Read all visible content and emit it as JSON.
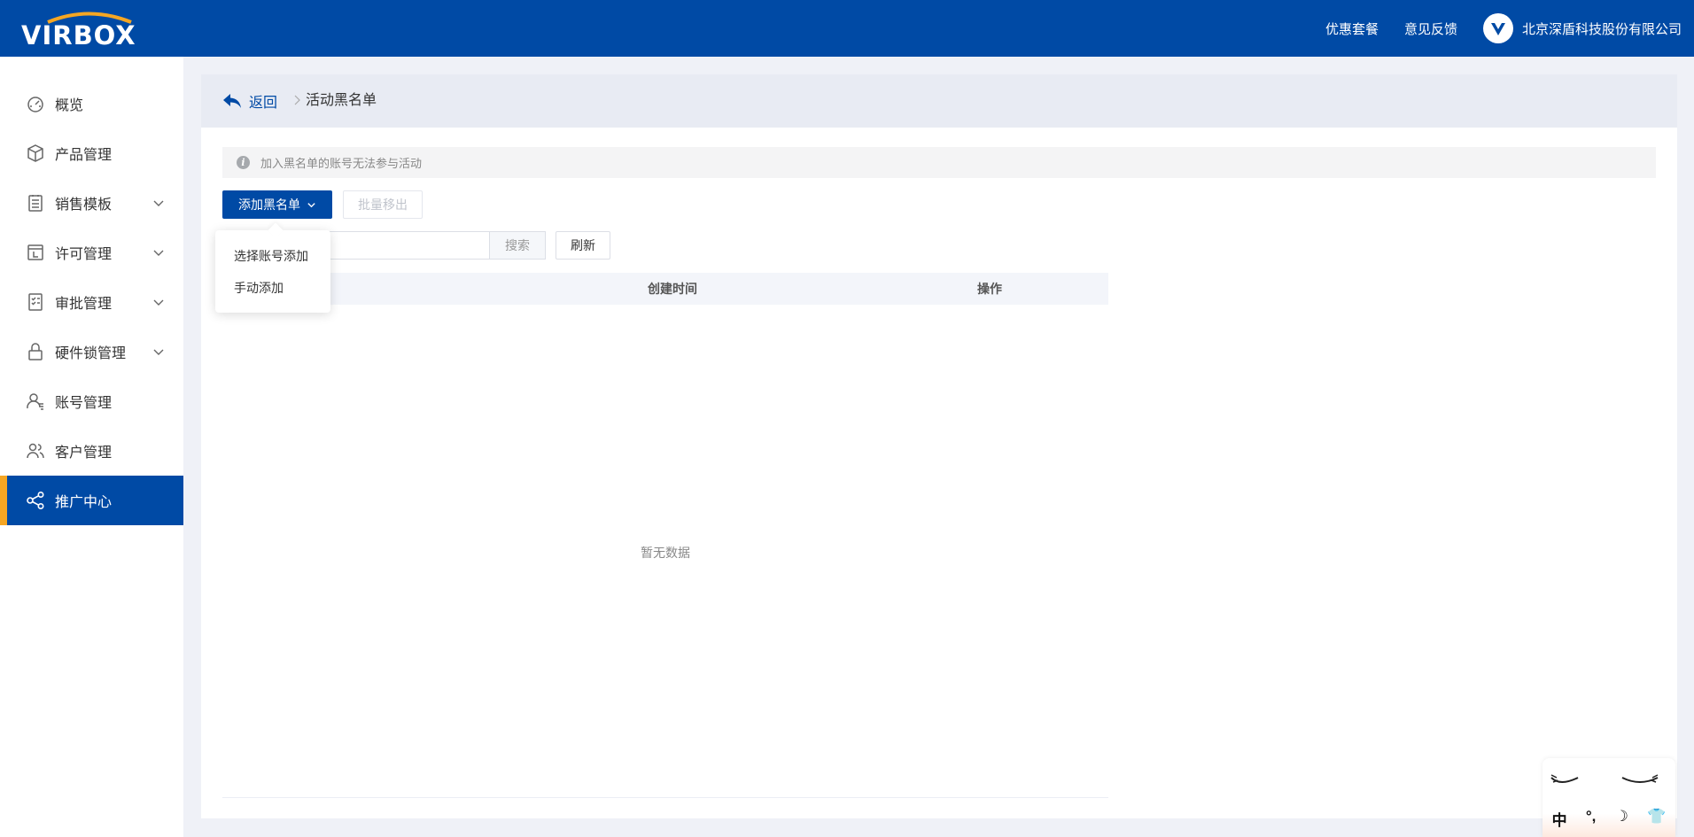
{
  "header": {
    "logo_text": "VIRBOX",
    "links": [
      "优惠套餐",
      "意见反馈"
    ],
    "company": "北京深盾科技股份有限公司",
    "bg_color": "#004aa5"
  },
  "sidebar": {
    "items": [
      {
        "label": "概览",
        "icon": "dashboard-icon",
        "expandable": false
      },
      {
        "label": "产品管理",
        "icon": "cube-icon",
        "expandable": false
      },
      {
        "label": "销售模板",
        "icon": "template-icon",
        "expandable": true
      },
      {
        "label": "许可管理",
        "icon": "license-icon",
        "expandable": true
      },
      {
        "label": "审批管理",
        "icon": "approval-icon",
        "expandable": true
      },
      {
        "label": "硬件锁管理",
        "icon": "lock-icon",
        "expandable": true
      },
      {
        "label": "账号管理",
        "icon": "user-icon",
        "expandable": false
      },
      {
        "label": "客户管理",
        "icon": "customers-icon",
        "expandable": false
      },
      {
        "label": "推广中心",
        "icon": "share-icon",
        "expandable": false,
        "active": true
      }
    ],
    "active_color": "#004aa5",
    "accent_color": "#f5a623"
  },
  "breadcrumb": {
    "back_label": "返回",
    "current": "活动黑名单"
  },
  "notice": {
    "text": "加入黑名单的账号无法参与活动"
  },
  "toolbar": {
    "add_label": "添加黑名单",
    "batch_remove_label": "批量移出",
    "search_placeholder": "",
    "search_label": "搜索",
    "refresh_label": "刷新"
  },
  "dropdown": {
    "items": [
      "选择账号添加",
      "手动添加"
    ]
  },
  "table": {
    "columns": [
      "创建时间",
      "操作"
    ],
    "empty_text": "暂无数据"
  },
  "ime": {
    "glyphs": [
      "中",
      "°,",
      "☽",
      "👕"
    ]
  }
}
